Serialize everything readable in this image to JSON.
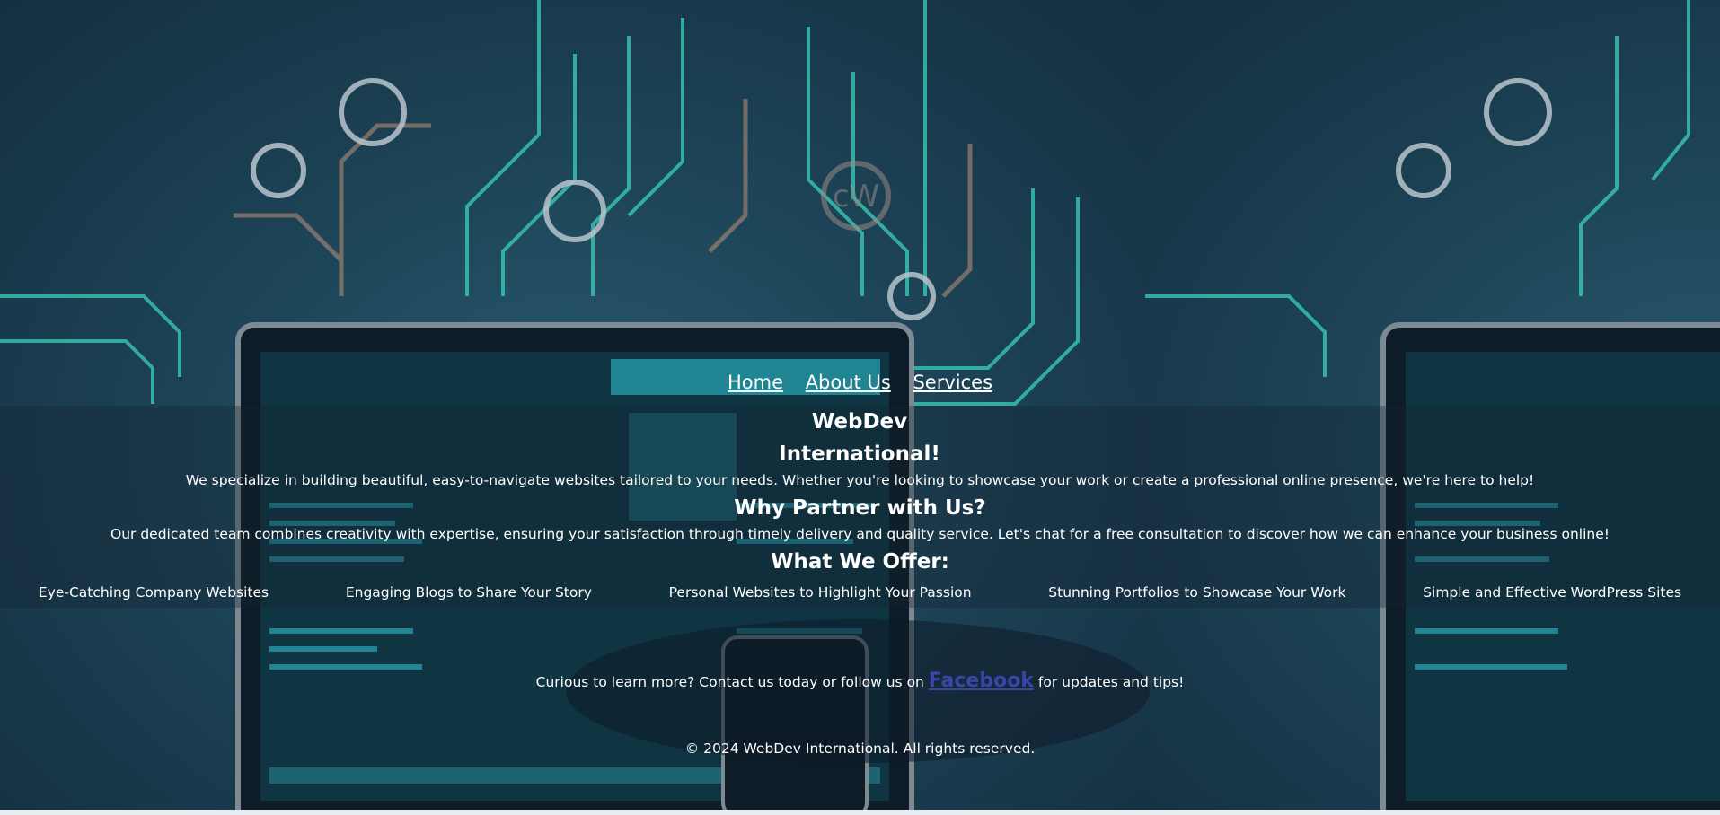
{
  "nav": {
    "home": "Home",
    "about": "About Us",
    "services": "Services"
  },
  "hero": {
    "title_line1": "WebDev",
    "title_line2": "International!",
    "intro": "We specialize in building beautiful, easy-to-navigate websites tailored to your needs. Whether you're looking to showcase your work or create a professional online presence, we're here to help!"
  },
  "why": {
    "heading": "Why Partner with Us?",
    "text": "Our dedicated team combines creativity with expertise, ensuring your satisfaction through timely delivery and quality service. Let's chat for a free consultation to discover how we can enhance your business online!"
  },
  "offer": {
    "heading": "What We Offer:",
    "items": [
      "Eye-Catching Company Websites",
      "Engaging Blogs to Share Your Story",
      "Personal Websites to Highlight Your Passion",
      "Stunning Portfolios to Showcase Your Work",
      "Simple and Effective WordPress Sites"
    ]
  },
  "cta": {
    "before": "Curious to learn more? Contact us today or follow us on ",
    "link": "Facebook",
    "after": " for updates and tips!"
  },
  "footer": {
    "text": "© 2024 WebDev International. All rights reserved."
  },
  "colors": {
    "background_dark": "#142f40",
    "circuit_teal": "#3ad1b8",
    "link_blue": "#3b44a8"
  },
  "icons": {
    "logo": "cw-circle-logo"
  }
}
